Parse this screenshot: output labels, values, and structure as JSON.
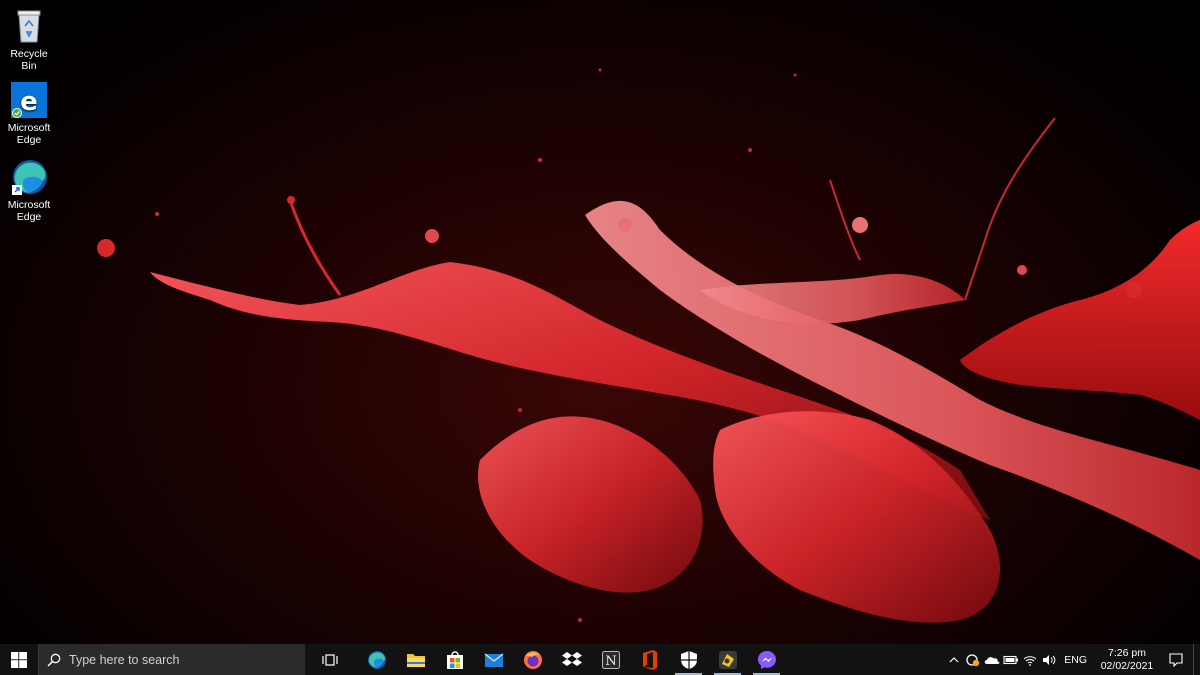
{
  "desktop": {
    "icons": [
      {
        "label": "Recycle Bin",
        "icon": "recycle-bin-icon"
      },
      {
        "label": "Microsoft\nEdge",
        "icon": "edge-legacy-icon"
      },
      {
        "label": "Microsoft\nEdge",
        "icon": "edge-chromium-icon"
      }
    ],
    "wallpaper": "red-paint-splash"
  },
  "taskbar": {
    "start_icon": "windows-logo-icon",
    "search_placeholder": "Type here to search",
    "task_view_icon": "task-view-icon",
    "pinned_apps": [
      {
        "name": "Microsoft Edge",
        "icon": "edge-icon",
        "running": false
      },
      {
        "name": "File Explorer",
        "icon": "folder-icon",
        "running": false
      },
      {
        "name": "Microsoft Store",
        "icon": "store-icon",
        "running": false
      },
      {
        "name": "Mail",
        "icon": "mail-icon",
        "running": false
      },
      {
        "name": "Firefox",
        "icon": "firefox-icon",
        "running": false
      },
      {
        "name": "Dropbox",
        "icon": "dropbox-icon",
        "running": false
      },
      {
        "name": "Notion",
        "icon": "notion-icon",
        "running": false
      },
      {
        "name": "Office",
        "icon": "office-icon",
        "running": false
      },
      {
        "name": "Windows Security",
        "icon": "shield-icon",
        "running": true
      },
      {
        "name": "Sticky app",
        "icon": "yellow-app-icon",
        "running": true
      },
      {
        "name": "Messenger",
        "icon": "messenger-icon",
        "running": true
      }
    ],
    "tray": {
      "icons": [
        "chevron-up-icon",
        "security-tray-icon",
        "onedrive-icon",
        "battery-icon",
        "wifi-icon",
        "volume-icon"
      ],
      "language": "ENG",
      "time": "7:26 pm",
      "date": "02/02/2021",
      "notification_icon": "notification-icon"
    }
  },
  "colors": {
    "taskbar_bg": "#121212",
    "search_bg": "#2b2b2b",
    "edge_blue": "#0a74d9",
    "paint_red": "#d8282c"
  }
}
